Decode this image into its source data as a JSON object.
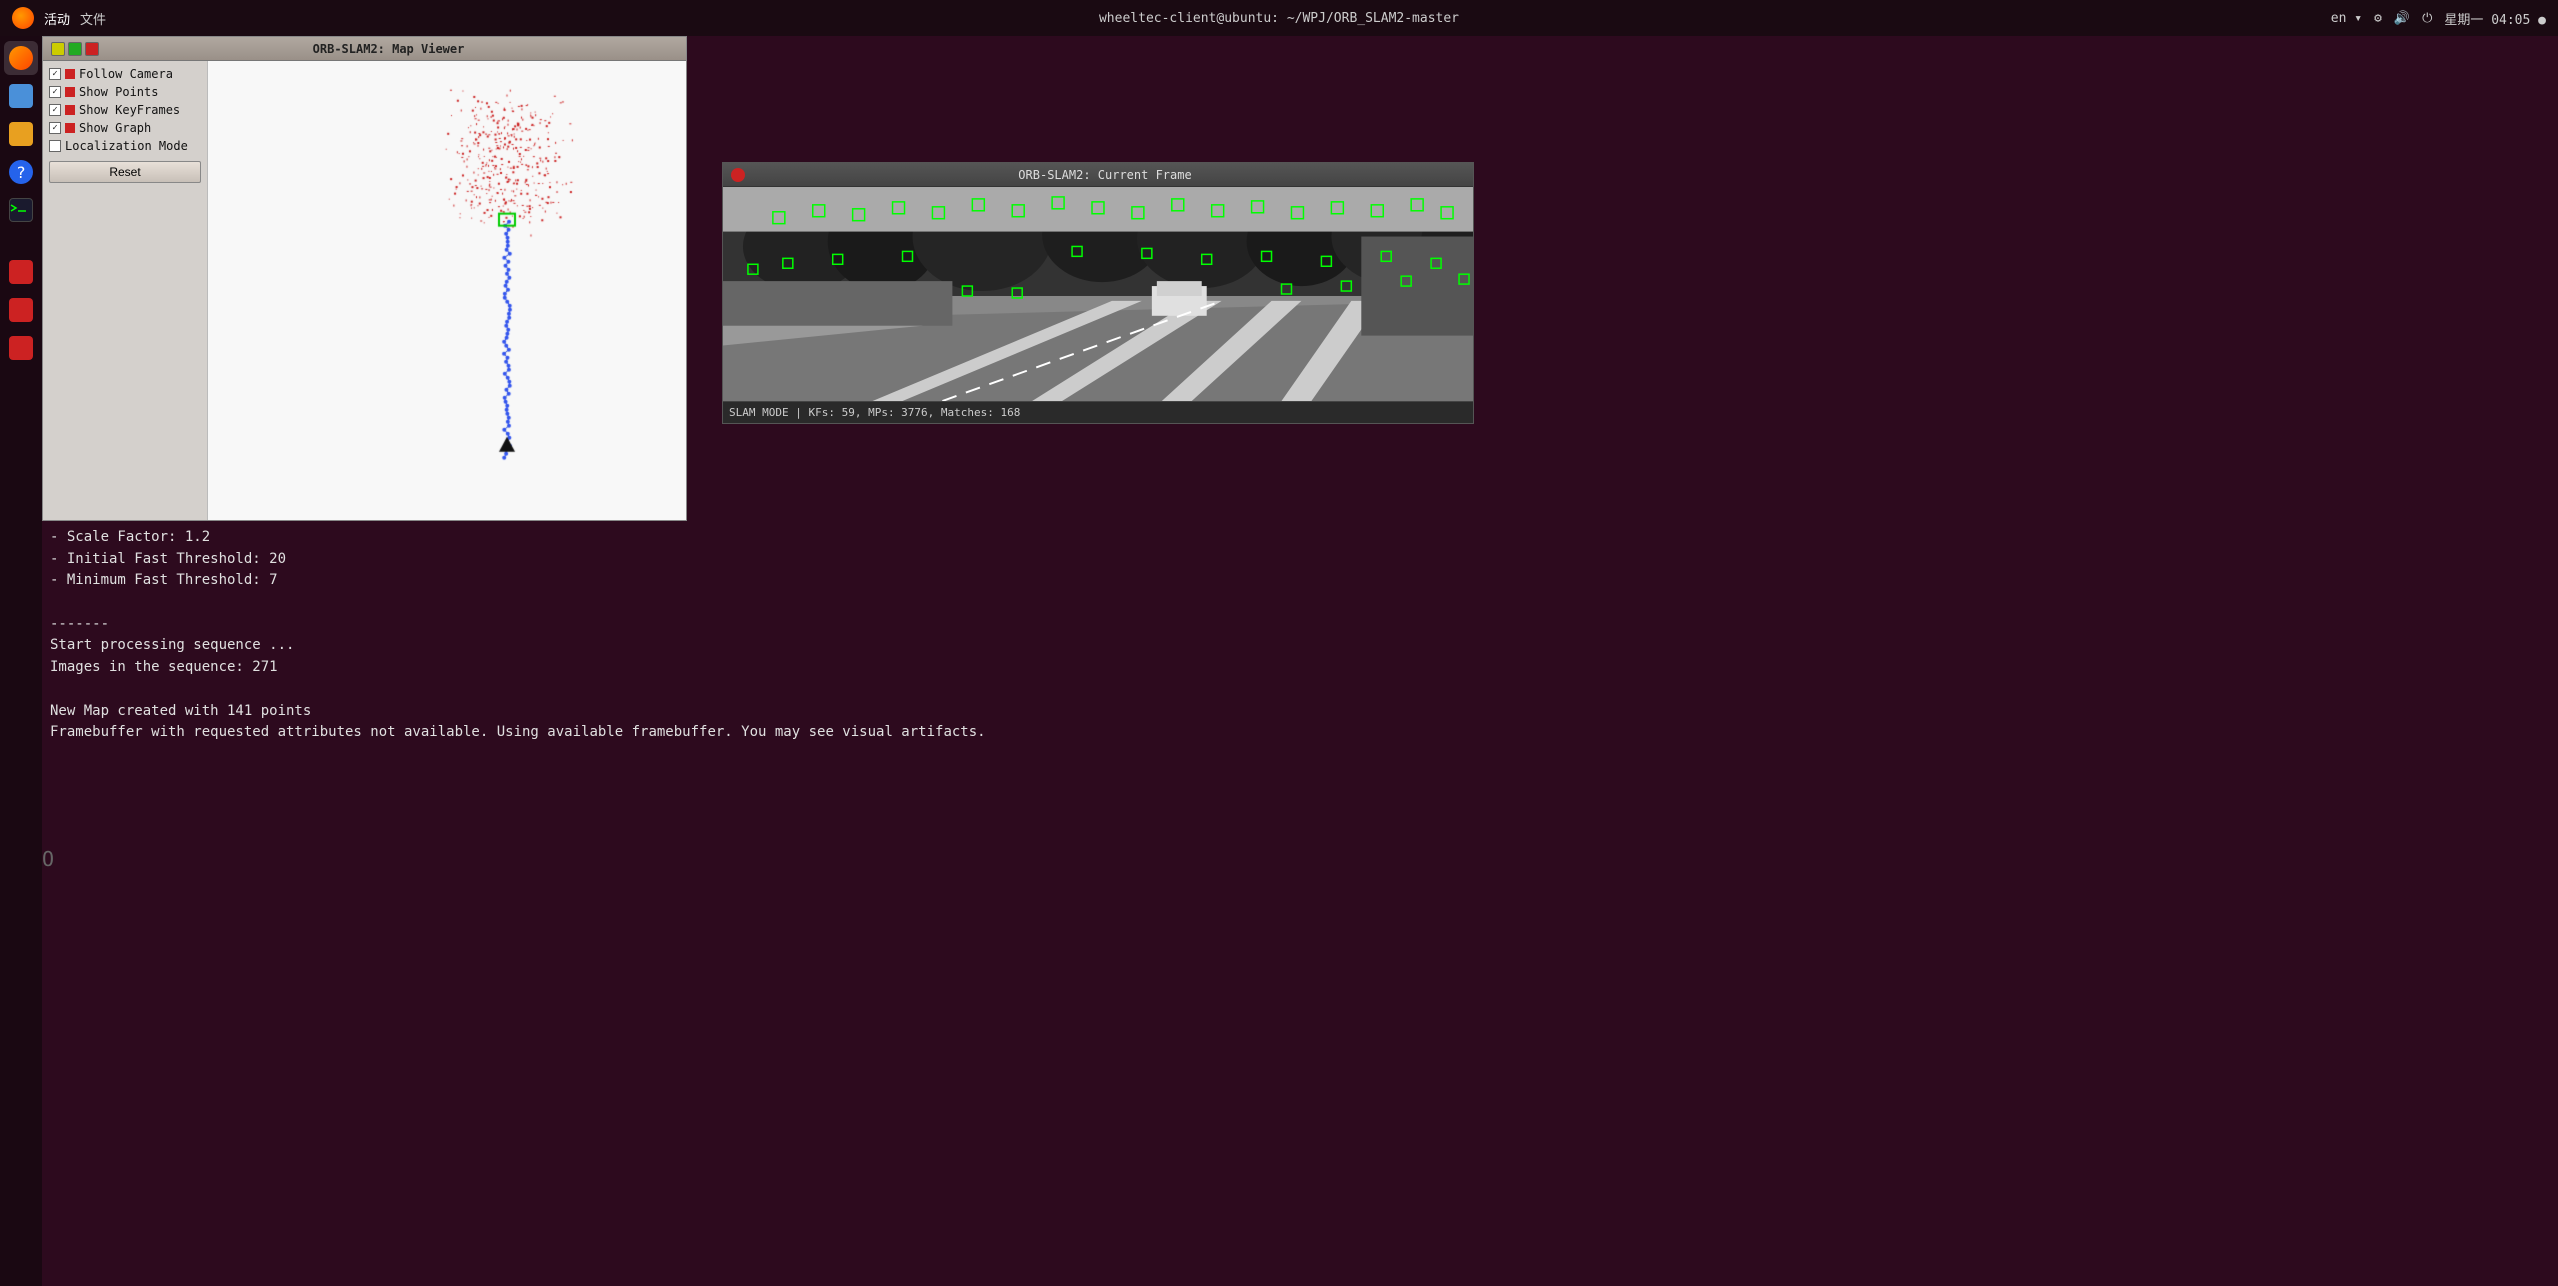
{
  "systembar": {
    "activities": "活动",
    "app_menu": "文件",
    "time": "星期一 04:05 ●",
    "locale": "en ▾",
    "hostname": "wheeltec-client@ubuntu: ~/WPJ/ORB_SLAM2-master",
    "right_icons": "⏻"
  },
  "map_viewer": {
    "title": "ORB-SLAM2: Map Viewer",
    "controls": {
      "follow_camera": "Follow Camera",
      "show_points": "Show Points",
      "show_keyframes": "Show KeyFrames",
      "show_graph": "Show Graph",
      "localization_mode": "Localization Mode",
      "reset_button": "Reset"
    }
  },
  "current_frame": {
    "title": "ORB-SLAM2: Current Frame",
    "status": "SLAM MODE |  KFs: 59, MPs: 3776, Matches: 168"
  },
  "terminal": {
    "lines": [
      "- Scale Factor: 1.2",
      "- Initial Fast Threshold: 20",
      "- Minimum Fast Threshold: 7",
      "",
      "-------",
      "Start processing sequence ...",
      "Images in the sequence: 271",
      "",
      "New Map created with 141 points",
      "Framebuffer with requested attributes not available. Using available framebuffer. You may see visual artifacts."
    ]
  }
}
